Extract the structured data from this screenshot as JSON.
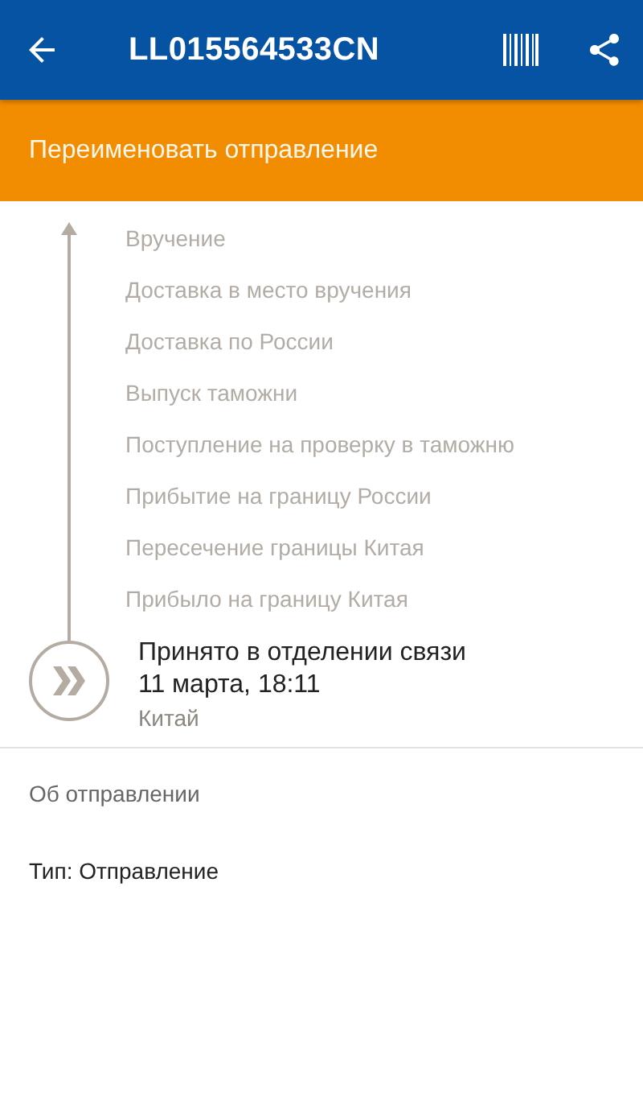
{
  "toolbar": {
    "title": "LL015564533CN"
  },
  "rename_bar": {
    "label": "Переименовать отправление"
  },
  "timeline": {
    "upcoming": [
      "Вручение",
      "Доставка в место вручения",
      "Доставка по России",
      "Выпуск таможни",
      "Поступление на проверку в таможню",
      "Прибытие на границу России",
      "Пересечение границы Китая",
      "Прибыло на границу Китая"
    ],
    "current": {
      "status": "Принято в отделении связи",
      "date": "11 марта, 18:11",
      "place": "Китай"
    }
  },
  "details": {
    "heading": "Об отправлении",
    "type_line": "Тип: Отправление"
  }
}
